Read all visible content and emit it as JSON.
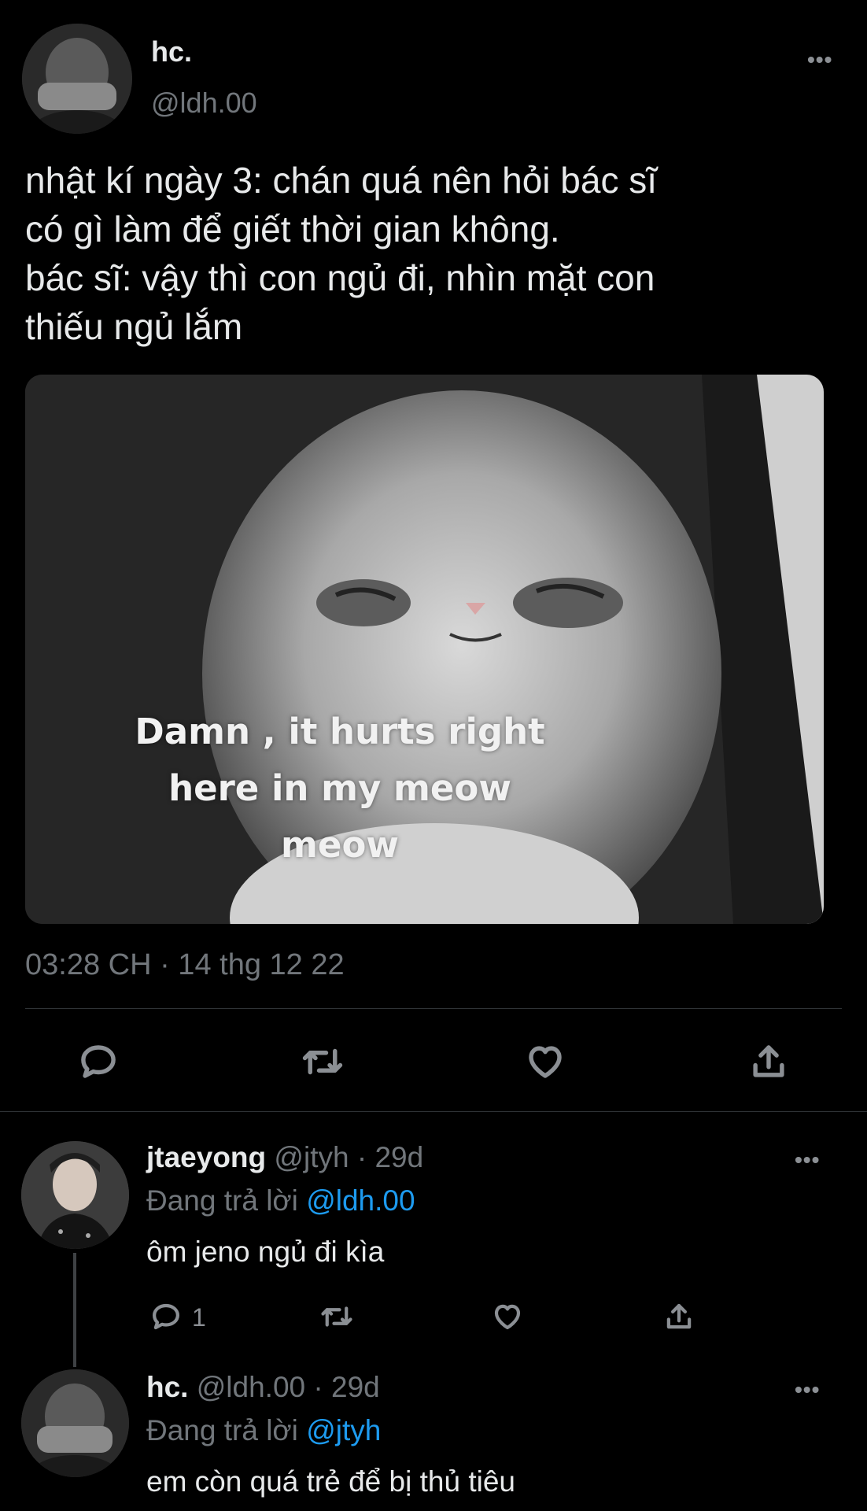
{
  "tweet": {
    "author_name": "hc.",
    "author_handle": "@ldh.00",
    "text_lines": [
      "nhật kí ngày 3: chán quá nên hỏi bác sĩ",
      "có gì làm để giết thời gian không.",
      "bác sĩ: vậy thì con ngủ đi, nhìn mặt con",
      "thiếu ngủ lắm"
    ],
    "image_caption_lines": [
      "Damn , it hurts right",
      "here in my meow",
      "meow"
    ],
    "timestamp": "03:28 CH · 14 thg 12 22",
    "more_label": "•••"
  },
  "replies": [
    {
      "author_name": "jtaeyong",
      "author_handle": "@jtyh",
      "age": "· 29d",
      "replying_prefix": "Đang trả lời",
      "replying_to": "@ldh.00",
      "text": "ôm jeno ngủ đi kìa",
      "reply_count": "1",
      "more_label": "•••"
    },
    {
      "author_name": "hc.",
      "author_handle": "@ldh.00",
      "age": "· 29d",
      "replying_prefix": "Đang trả lời",
      "replying_to": "@jtyh",
      "text": "em còn quá trẻ để bị thủ tiêu",
      "more_label": "•••"
    }
  ],
  "icons": [
    "reply-icon",
    "retweet-icon",
    "like-icon",
    "share-icon",
    "more-icon"
  ],
  "colors": {
    "background": "#000000",
    "text": "#e7e9ea",
    "muted": "#71767b",
    "link": "#1d9bf0",
    "divider": "#2f3336"
  }
}
